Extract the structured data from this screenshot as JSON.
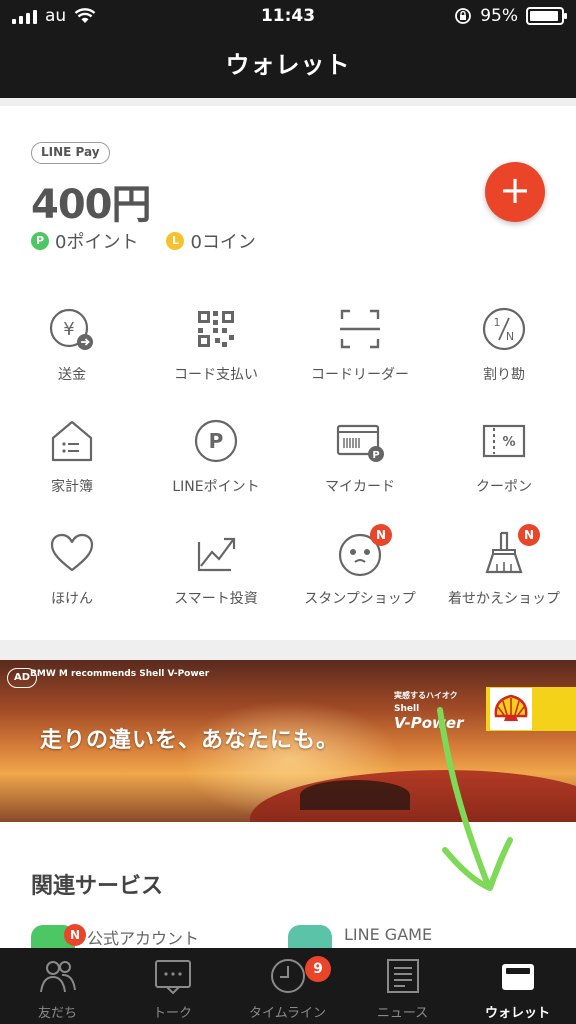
{
  "status_bar": {
    "carrier": "au",
    "time": "11:43",
    "battery": "95%"
  },
  "header": {
    "title": "ウォレット"
  },
  "wallet": {
    "brand_badge": "LINE Pay",
    "balance": "400円",
    "points": "0ポイント",
    "coins": "0コイン",
    "point_icon": "P",
    "coin_icon": "L",
    "add_label": "+"
  },
  "menu": [
    {
      "label": "送金",
      "icon": "send-money-icon"
    },
    {
      "label": "コード支払い",
      "icon": "qr-code-icon"
    },
    {
      "label": "コードリーダー",
      "icon": "code-reader-icon"
    },
    {
      "label": "割り勘",
      "icon": "split-bill-icon"
    },
    {
      "label": "家計簿",
      "icon": "household-book-icon"
    },
    {
      "label": "LINEポイント",
      "icon": "line-points-icon"
    },
    {
      "label": "マイカード",
      "icon": "my-card-icon"
    },
    {
      "label": "クーポン",
      "icon": "coupon-icon"
    },
    {
      "label": "ほけん",
      "icon": "insurance-heart-icon"
    },
    {
      "label": "スマート投資",
      "icon": "smart-invest-icon"
    },
    {
      "label": "スタンプショップ",
      "icon": "sticker-shop-icon",
      "badge": "N"
    },
    {
      "label": "着せかえショップ",
      "icon": "theme-shop-icon",
      "badge": "N"
    }
  ],
  "ad": {
    "tag": "AD",
    "header": "BMW M recommends Shell V-Power",
    "headline": "走りの違いを、あなたにも。",
    "tagline_small": "実感するハイオク",
    "brand_line1": "Shell",
    "brand_line2": "V-Power"
  },
  "related": {
    "title": "関連サービス",
    "items": [
      {
        "label": "公式アカウント",
        "badge": "N"
      },
      {
        "label": "LINE GAME"
      }
    ]
  },
  "tabs": [
    {
      "label": "友だち",
      "icon": "friends-icon"
    },
    {
      "label": "トーク",
      "icon": "chat-icon"
    },
    {
      "label": "タイムライン",
      "icon": "timeline-clock-icon",
      "badge": "9"
    },
    {
      "label": "ニュース",
      "icon": "news-icon"
    },
    {
      "label": "ウォレット",
      "icon": "wallet-icon",
      "active": true
    }
  ],
  "colors": {
    "accent": "#ea4529",
    "green": "#4cc764",
    "yellow": "#f5c12c",
    "dark": "#191919"
  }
}
